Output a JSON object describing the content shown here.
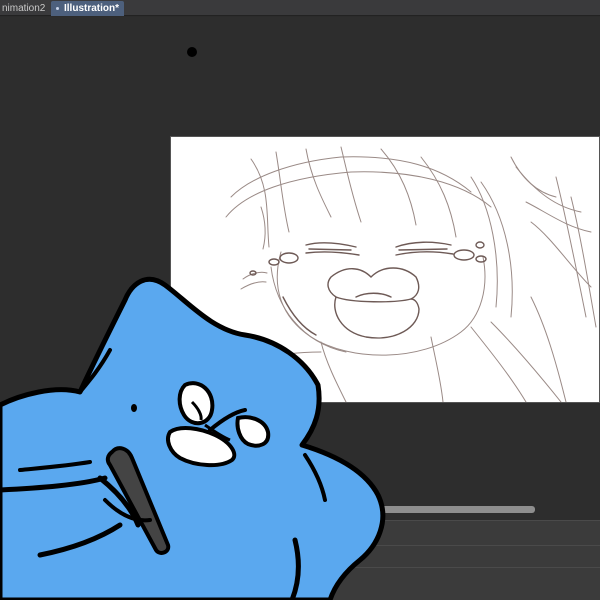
{
  "tabs": [
    {
      "label": "nimation2",
      "active": false
    },
    {
      "label": "Illustration*",
      "active": true
    }
  ],
  "colors": {
    "tab_active": "#4d607d",
    "workspace": "#2d2d2d",
    "canvas": "#ffffff",
    "sketch_line": "#8a7570",
    "mascot_fill": "#5aa8ef",
    "mascot_outline": "#000000"
  },
  "icons": {
    "brush_cursor": "brush-cursor-icon"
  }
}
